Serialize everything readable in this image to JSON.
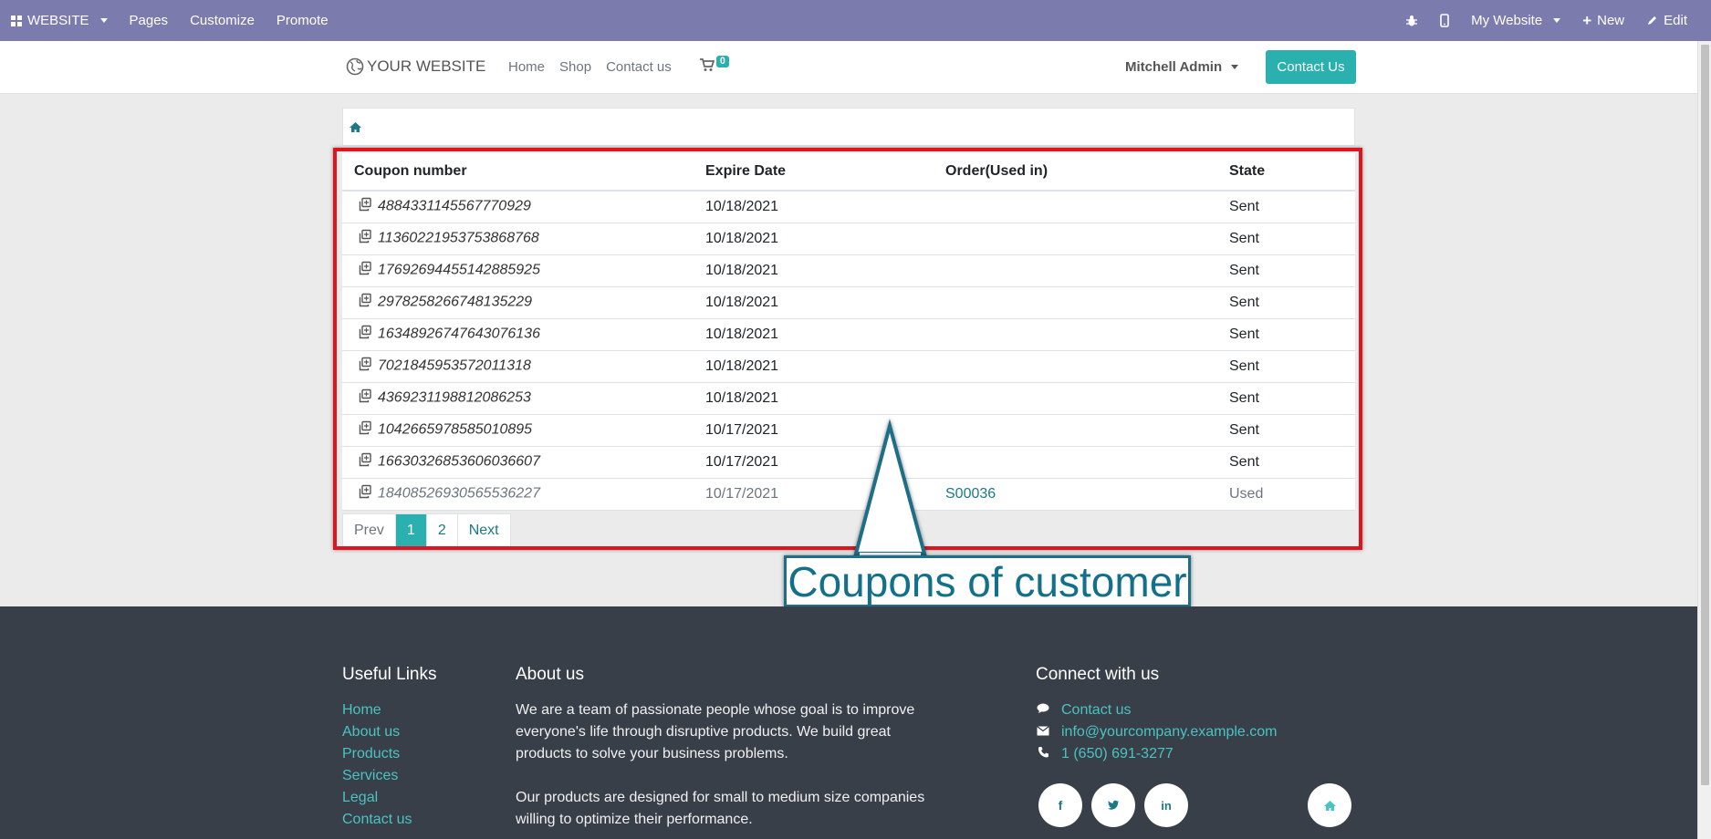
{
  "adminbar": {
    "app_label": "WEBSITE",
    "menu": [
      "Pages",
      "Customize",
      "Promote"
    ],
    "website_switcher": "My Website",
    "new_label": "New",
    "edit_label": "Edit"
  },
  "header": {
    "logo_text": "YOUR WEBSITE",
    "nav": [
      "Home",
      "Shop",
      "Contact us"
    ],
    "cart_count": "0",
    "user": "Mitchell Admin",
    "cta": "Contact Us"
  },
  "table": {
    "headers": [
      "Coupon number",
      "Expire Date",
      "Order(Used in)",
      "State"
    ],
    "rows": [
      {
        "code": "4884331145567770929",
        "expire": "10/18/2021",
        "order": "",
        "state": "Sent"
      },
      {
        "code": "11360221953753868768",
        "expire": "10/18/2021",
        "order": "",
        "state": "Sent"
      },
      {
        "code": "17692694455142885925",
        "expire": "10/18/2021",
        "order": "",
        "state": "Sent"
      },
      {
        "code": "2978258266748135229",
        "expire": "10/18/2021",
        "order": "",
        "state": "Sent"
      },
      {
        "code": "16348926747643076136",
        "expire": "10/18/2021",
        "order": "",
        "state": "Sent"
      },
      {
        "code": "7021845953572011318",
        "expire": "10/18/2021",
        "order": "",
        "state": "Sent"
      },
      {
        "code": "4369231198812086253",
        "expire": "10/18/2021",
        "order": "",
        "state": "Sent"
      },
      {
        "code": "1042665978585010895",
        "expire": "10/17/2021",
        "order": "",
        "state": "Sent"
      },
      {
        "code": "16630326853606036607",
        "expire": "10/17/2021",
        "order": "",
        "state": "Sent"
      },
      {
        "code": "18408526930565536227",
        "expire": "10/17/2021",
        "order": "S00036",
        "state": "Used"
      }
    ]
  },
  "pager": {
    "prev": "Prev",
    "pages": [
      "1",
      "2"
    ],
    "next": "Next"
  },
  "annotation": {
    "label": "Coupons of customer"
  },
  "footer": {
    "useful_links_title": "Useful Links",
    "useful_links": [
      "Home",
      "About us",
      "Products",
      "Services",
      "Legal",
      "Contact us"
    ],
    "about_title": "About us",
    "about_p1": "We are a team of passionate people whose goal is to improve everyone's life through disruptive products. We build great products to solve your business problems.",
    "about_p2": "Our products are designed for small to medium size companies willing to optimize their performance.",
    "connect_title": "Connect with us",
    "contact_link": "Contact us",
    "email": "info@yourcompany.example.com",
    "phone": "1 (650) 691-3277"
  },
  "colors": {
    "primary": "#2bb0b0",
    "admin_bar": "#7c7bad",
    "footer": "#393f49",
    "annotation_red": "#e0141e",
    "annotation_blue": "#1c6f86"
  }
}
